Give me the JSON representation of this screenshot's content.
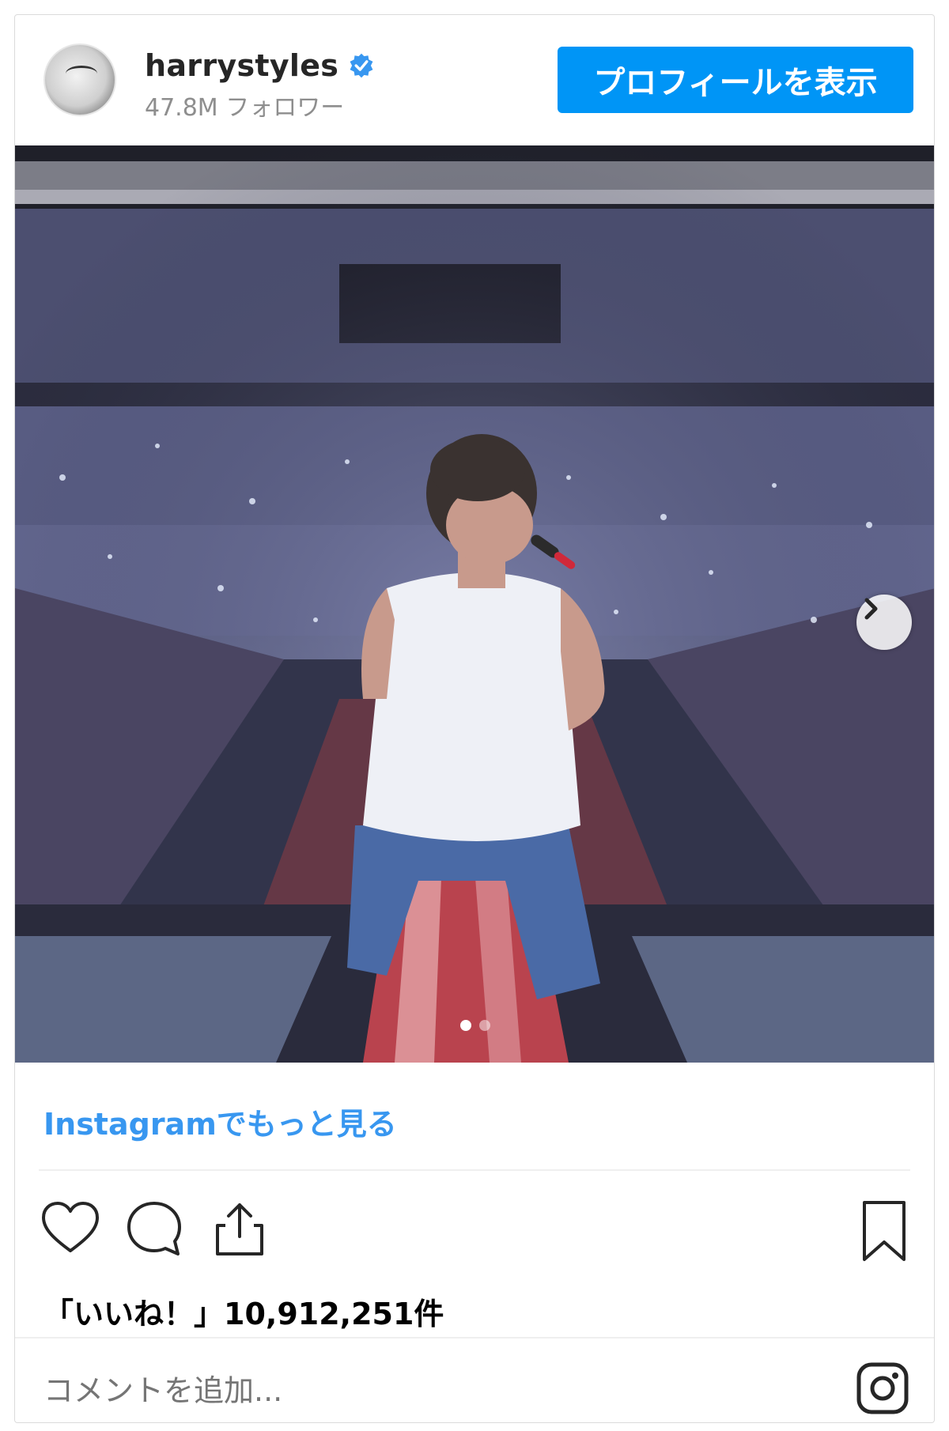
{
  "header": {
    "username": "harrystyles",
    "followers": "47.8M フォロワー",
    "profile_button": "プロフィールを表示"
  },
  "post": {
    "carousel": {
      "current": 1,
      "total": 2
    }
  },
  "more_link": "Instagramでもっと見る",
  "likes": "「いいね！」10,912,251件",
  "comment": {
    "placeholder": "コメントを追加..."
  },
  "icons": [
    "avatar",
    "verified-badge-icon",
    "chevron-right-icon",
    "heart-icon",
    "comment-icon",
    "share-icon",
    "bookmark-icon",
    "instagram-icon"
  ],
  "colors": {
    "accent": "#0095f6",
    "link": "#3897f0",
    "muted": "#8e8e8e"
  }
}
